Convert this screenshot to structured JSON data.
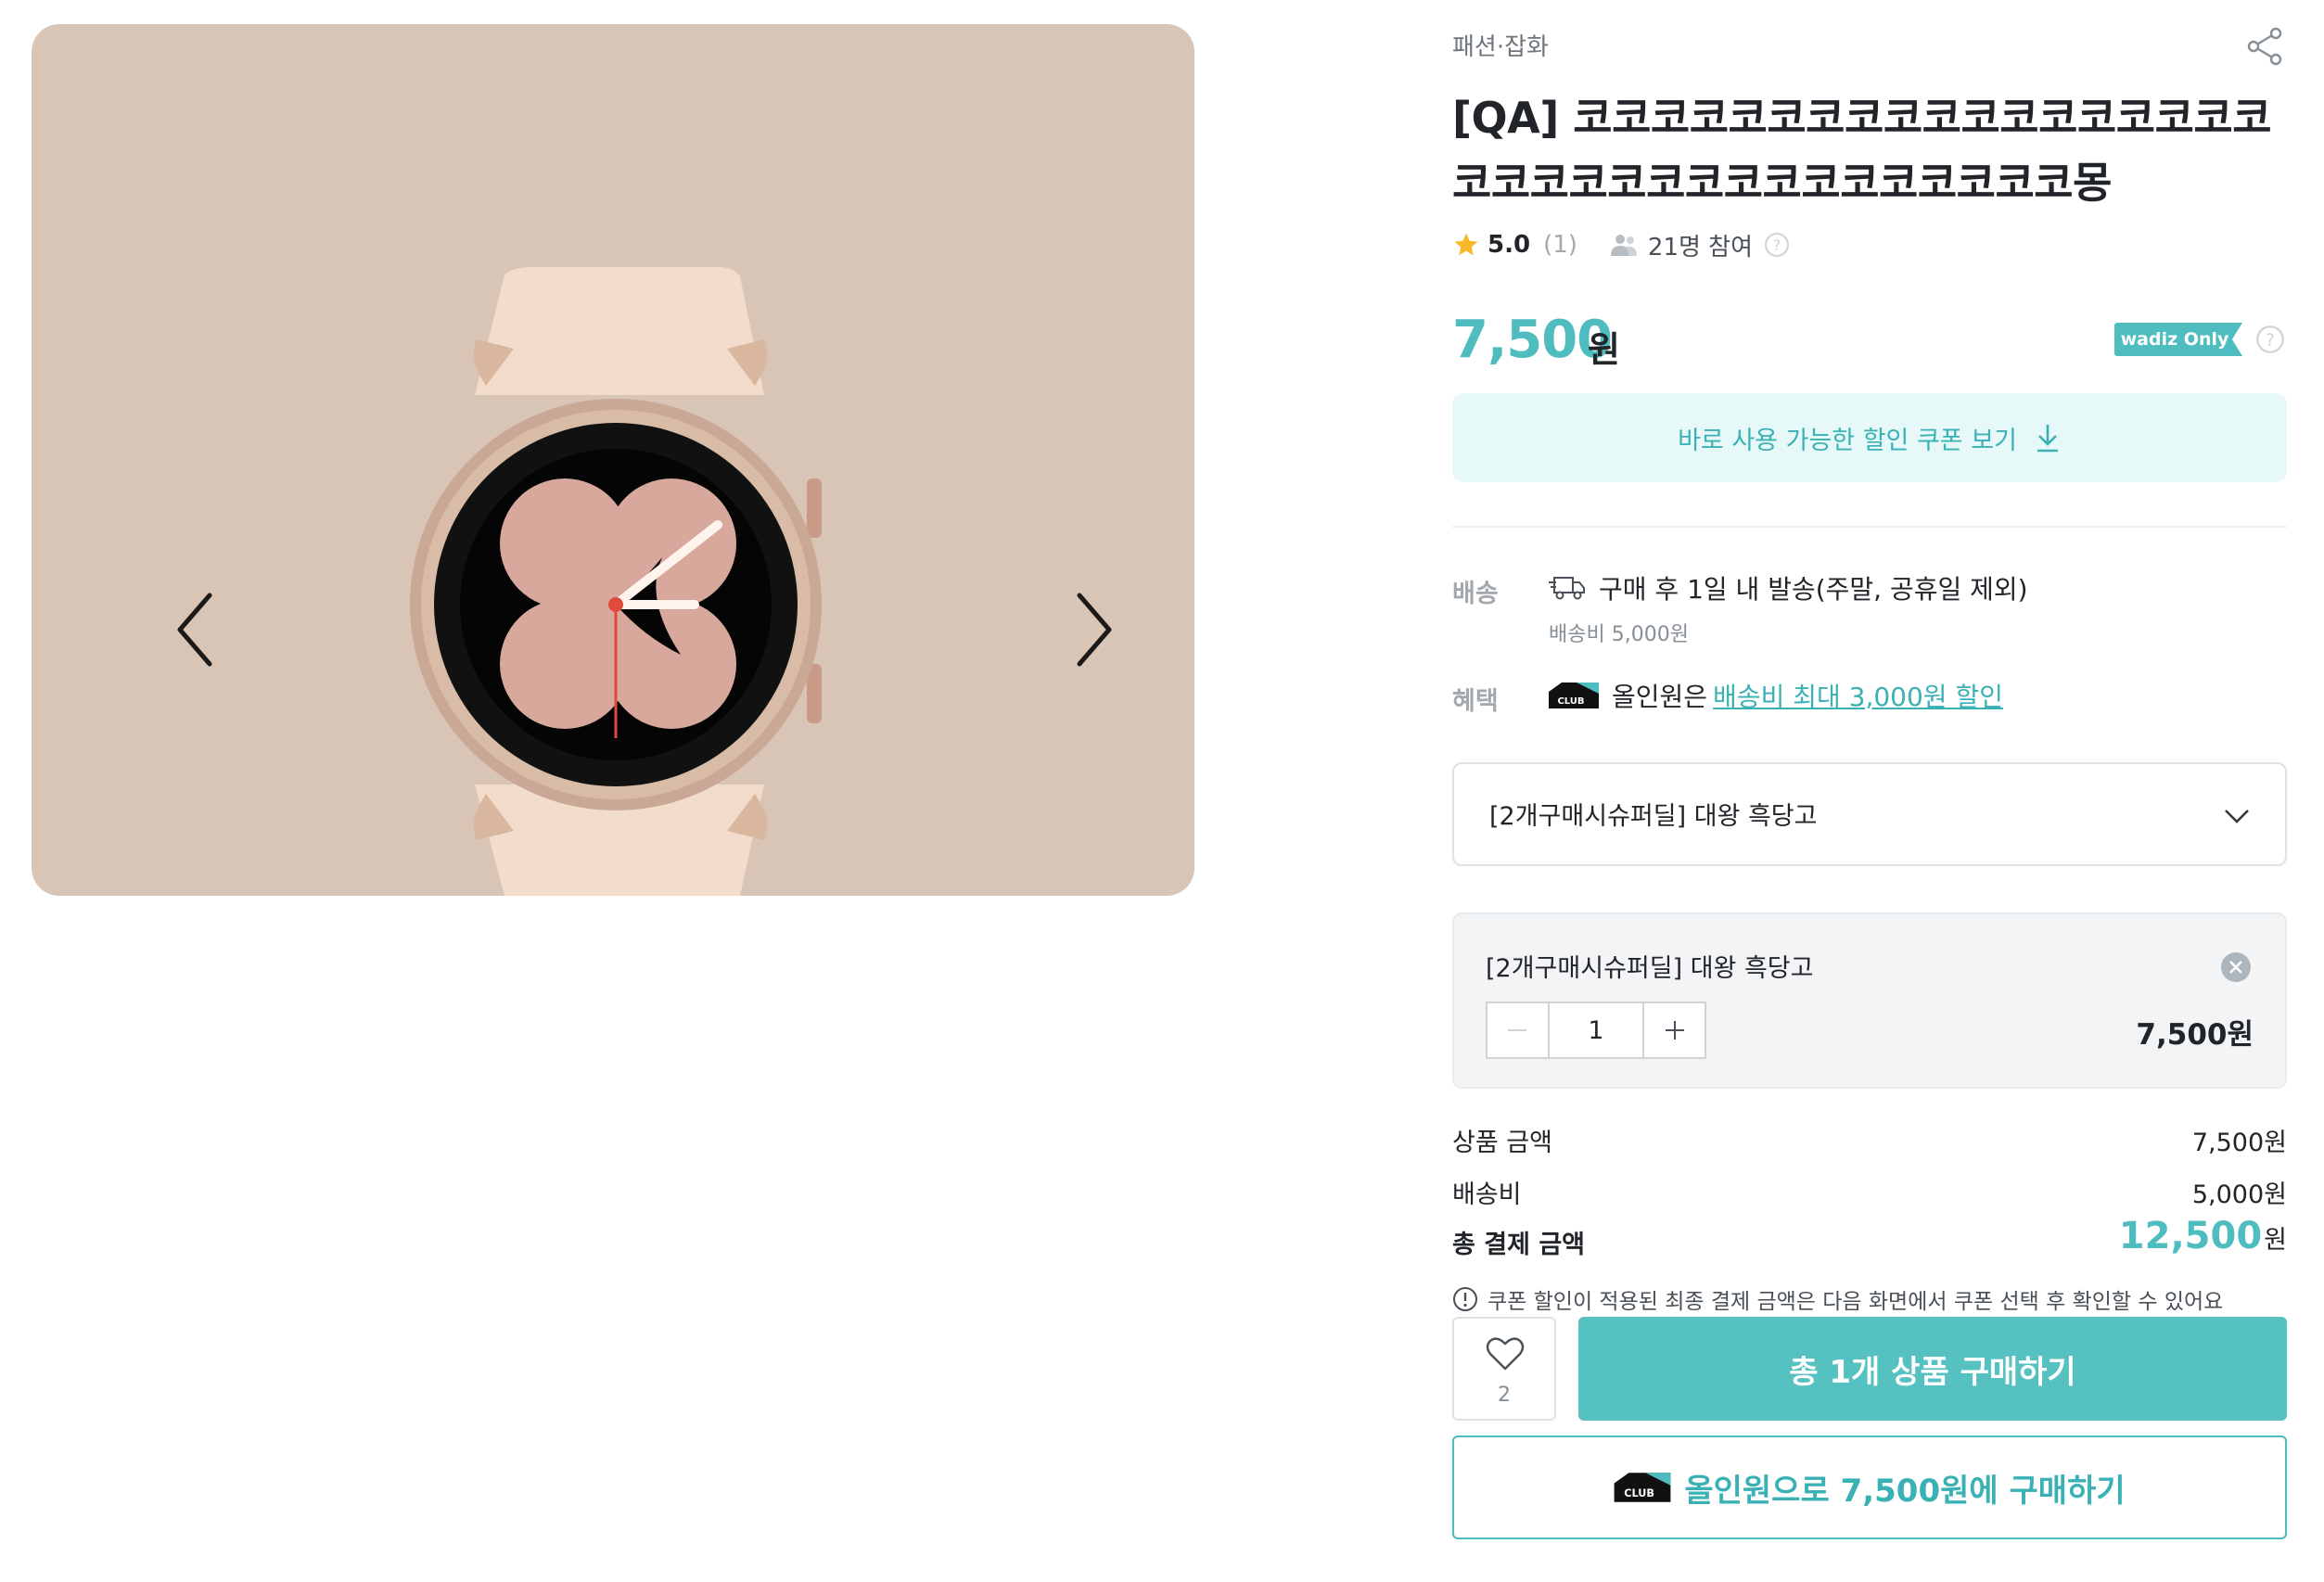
{
  "gallery": {
    "prev_icon": "chevron-left-icon",
    "next_icon": "chevron-right-icon",
    "image": "smartwatch-product-photo"
  },
  "product": {
    "category": "패션·잡화",
    "title": "[QA] 코코코코코코코코코코코코코코코코코코코코코코코코코코코코코코코코코코몽",
    "rating": "5.0",
    "review_count": "(1)",
    "participants": "21명 참여"
  },
  "price": {
    "amount": "7,500",
    "unit": "원",
    "badge": "wadiz Only"
  },
  "coupon": {
    "label": "바로 사용 가능한 할인 쿠폰 보기"
  },
  "shipping": {
    "label": "배송",
    "text": "구매 후 1일 내 발송(주말, 공휴일 제외)",
    "fee": "배송비 5,000원"
  },
  "benefit": {
    "label": "혜택",
    "club_badge": "CLUB",
    "prefix": "올인원은",
    "link": "배송비 최대 3,000원 할인"
  },
  "option_select": {
    "value": "[2개구매시슈퍼딜] 대왕 흑당고"
  },
  "selected_option": {
    "name": "[2개구매시슈퍼딜] 대왕 흑당고",
    "quantity": "1",
    "price": "7,500원"
  },
  "summary": {
    "product_label": "상품 금액",
    "product_value": "7,500원",
    "shipping_label": "배송비",
    "shipping_value": "5,000원",
    "total_label": "총 결제 금액",
    "total_value": "12,500",
    "total_unit": "원"
  },
  "notice": "쿠폰 할인이 적용된 최종 결제 금액은 다음 화면에서 쿠폰 선택 후 확인할 수 있어요",
  "actions": {
    "like_count": "2",
    "buy_label": "총 1개 상품 구매하기",
    "club_buy_label": "올인원으로 7,500원에 구매하기"
  },
  "colors": {
    "accent": "#4fbdc0",
    "buy_button": "#56c1c1",
    "coupon_bg": "#e7f8f8",
    "gallery_bg": "#d8c5b6"
  }
}
